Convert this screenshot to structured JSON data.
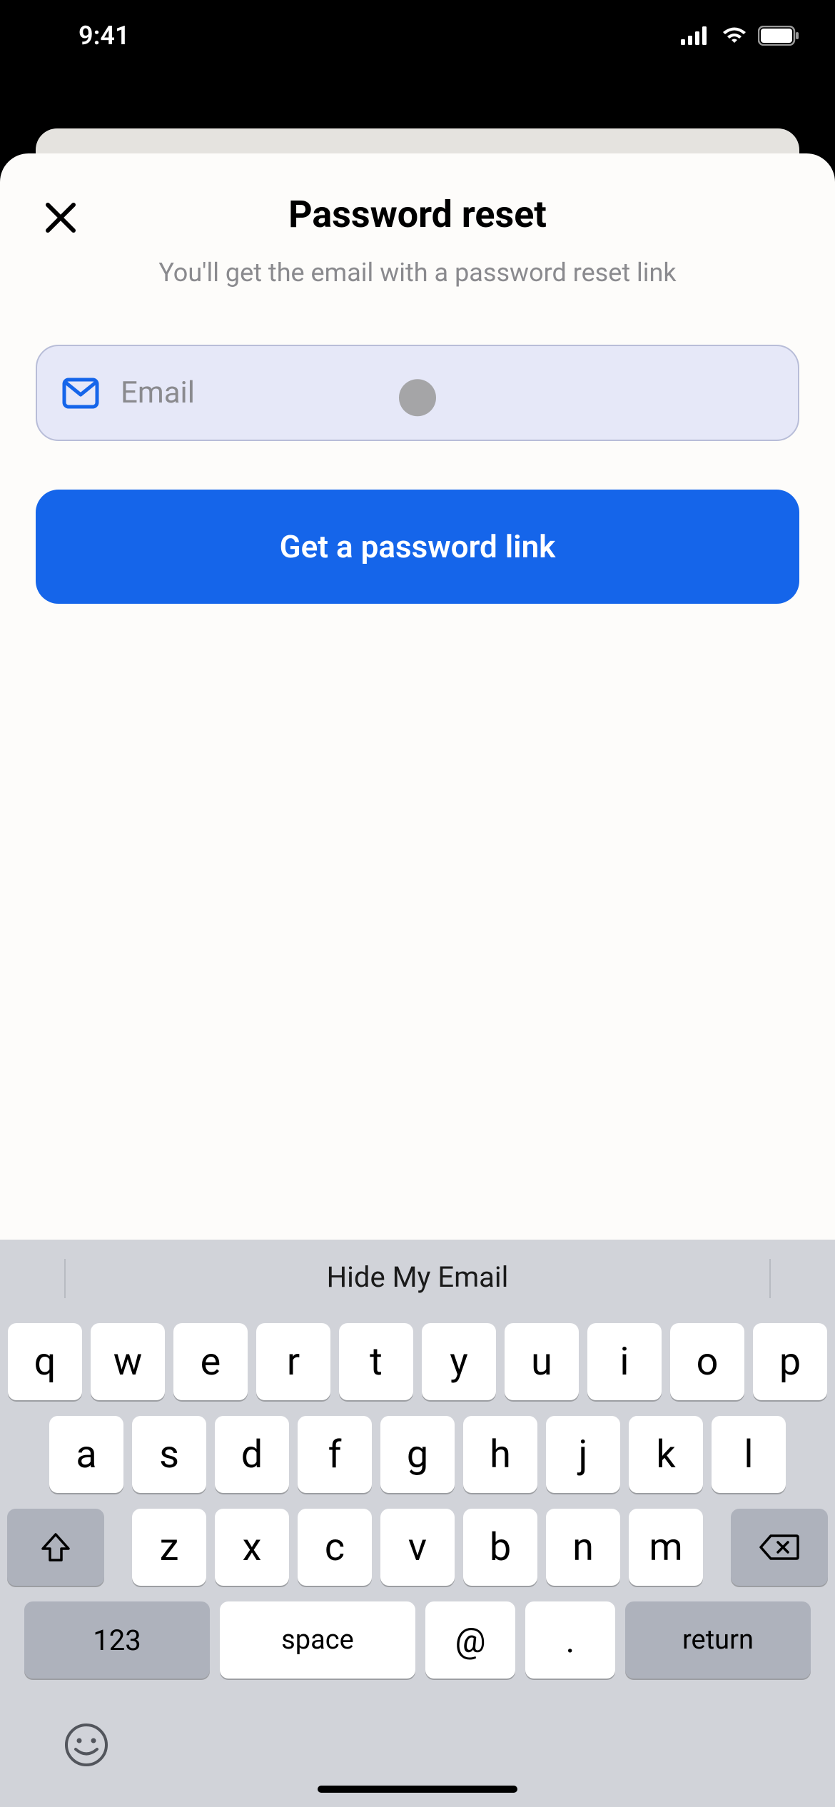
{
  "status": {
    "time": "9:41"
  },
  "modal": {
    "title": "Password reset",
    "subtitle": "You'll get the email with a password reset link",
    "email_placeholder": "Email",
    "email_value": "",
    "submit_label": "Get a password link"
  },
  "keyboard": {
    "suggestion": "Hide My Email",
    "row1": [
      "q",
      "w",
      "e",
      "r",
      "t",
      "y",
      "u",
      "i",
      "o",
      "p"
    ],
    "row2": [
      "a",
      "s",
      "d",
      "f",
      "g",
      "h",
      "j",
      "k",
      "l"
    ],
    "row3": [
      "z",
      "x",
      "c",
      "v",
      "b",
      "n",
      "m"
    ],
    "num_key": "123",
    "space_key": "space",
    "at_key": "@",
    "dot_key": ".",
    "return_key": "return"
  }
}
